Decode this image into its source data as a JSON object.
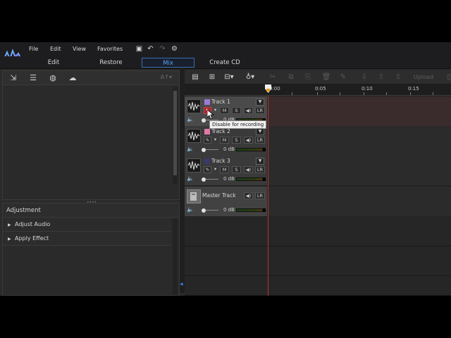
{
  "menu": {
    "items": [
      "File",
      "Edit",
      "View",
      "Favorites"
    ]
  },
  "mode_tabs": [
    {
      "label": "Edit",
      "active": false
    },
    {
      "label": "Restore",
      "active": false
    },
    {
      "label": "Mix",
      "active": true
    },
    {
      "label": "Create CD",
      "active": false
    }
  ],
  "library": {
    "font_size_label": "A↑▾"
  },
  "adjustment": {
    "title": "Adjustment",
    "sections": [
      "Adjust Audio",
      "Apply Effect"
    ]
  },
  "toolbar": {
    "upload_label": "Upload"
  },
  "ruler": {
    "labels": [
      "0:00",
      "0:05",
      "0:10",
      "0:15"
    ]
  },
  "tracks": [
    {
      "name": "Track 1",
      "color": "#9a7bd8",
      "db": "0 dB",
      "selected": true
    },
    {
      "name": "Track 2",
      "color": "#e07aa8",
      "db": "0 dB",
      "selected": false
    },
    {
      "name": "Track 3",
      "color": "#3a3a6a",
      "db": "0 dB",
      "selected": false
    }
  ],
  "master": {
    "name": "Master Track",
    "db": "0 dB"
  },
  "track_buttons": {
    "mute": "M",
    "solo": "S",
    "speaker": "◀)",
    "lr": "LR"
  },
  "tooltip": {
    "text": "Disable for recording"
  },
  "colors": {
    "accent": "#5aa0ff",
    "record": "#a8242d",
    "playhead": "#b83232"
  }
}
